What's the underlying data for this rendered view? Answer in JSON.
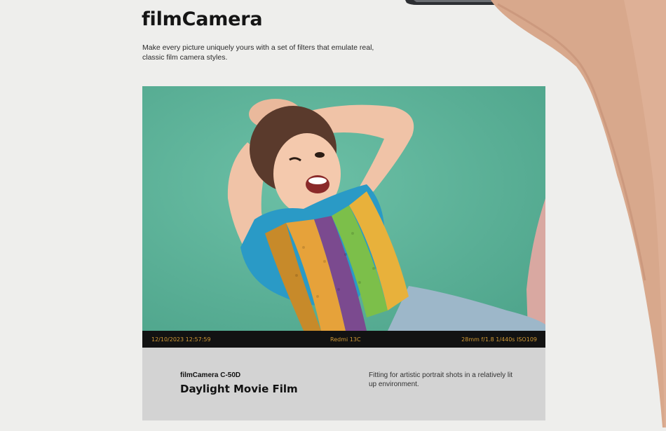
{
  "section": {
    "title": "filmCamera",
    "description": "Make every picture uniquely yours with a set of filters that emulate real, classic film camera styles."
  },
  "photo": {
    "exif_datetime": "12/10/2023  12:57:59",
    "exif_device": "Redmi 13C",
    "exif_settings": "28mm  f/1.8  1/440s  ISO109"
  },
  "filter": {
    "model": "filmCamera C-50D",
    "name": "Daylight Movie Film",
    "description": "Fitting for artistic portrait shots in a relatively lit up environment."
  },
  "colors": {
    "background": "#eeeeec",
    "exif_text": "#d29a35",
    "exif_bar": "#121212",
    "caption_bg": "#d3d3d3"
  }
}
